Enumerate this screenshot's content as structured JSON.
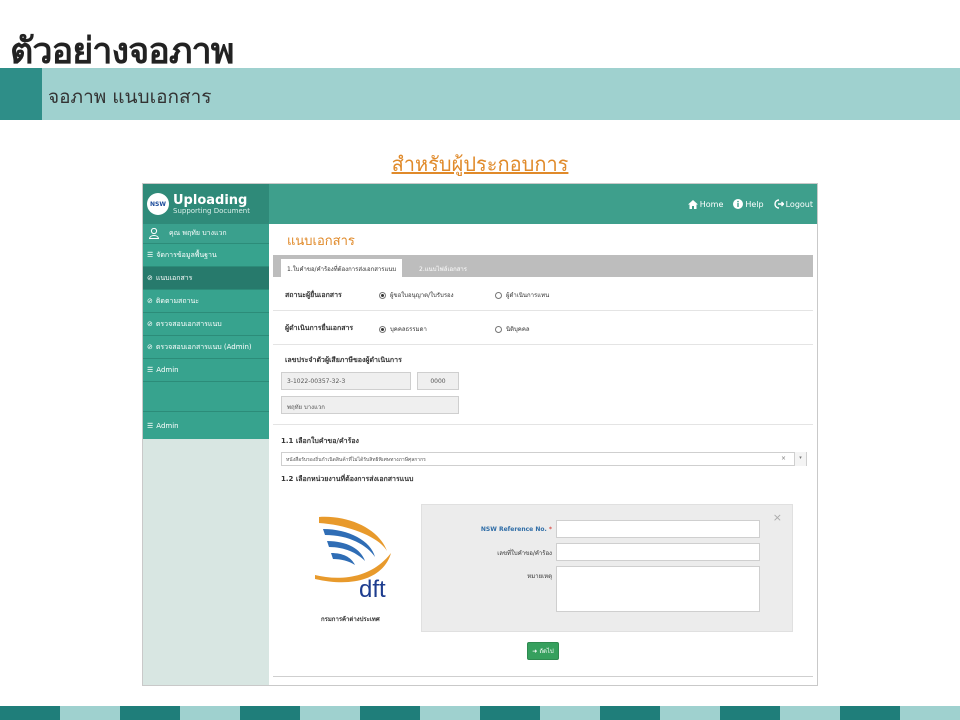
{
  "slide": {
    "title": "ตัวอย่างจอภาพ",
    "subtitle": "จอภาพ แนบเอกสาร",
    "section_heading": "สำหรับผู้ประกอบการ"
  },
  "app": {
    "brand": {
      "logo_text": "NSW",
      "title": "Uploading",
      "subtitle": "Supporting Document"
    },
    "topnav": [
      {
        "label": "Home",
        "icon": "home-icon"
      },
      {
        "label": "Help",
        "icon": "help-icon"
      },
      {
        "label": "Logout",
        "icon": "logout-icon"
      }
    ],
    "sidebar": {
      "user": "คุณ พฤทัย บางแวก",
      "items": [
        {
          "label": "จัดการข้อมูลพื้นฐาน",
          "icon": "menu-icon"
        },
        {
          "label": "แนบเอกสาร",
          "icon": "check-circle-icon"
        },
        {
          "label": "ติดตามสถานะ",
          "icon": "check-circle-icon"
        },
        {
          "label": "ตรวจสอบเอกสารแนบ",
          "icon": "check-circle-icon"
        },
        {
          "label": "ตรวจสอบเอกสารแนบ (Admin)",
          "icon": "check-circle-icon"
        },
        {
          "label": "Admin",
          "icon": "menu-icon"
        }
      ],
      "admin_second": "Admin"
    },
    "page_title": "แนบเอกสาร",
    "tabs": {
      "active": "1.ใบคำขอ/คำร้องที่ต้องการส่งเอกสารแนบ",
      "inactive": "2.แนบไฟล์เอกสาร"
    },
    "submitter_status": {
      "label": "สถานะผู้ยื่นเอกสาร",
      "options": [
        "ผู้ขอใบอนุญาต/ใบรับรอง",
        "ผู้ดำเนินการแทน"
      ],
      "selected": 0
    },
    "submitter_type": {
      "label": "ผู้ดำเนินการยื่นเอกสาร",
      "options": [
        "บุคคลธรรมดา",
        "นิติบุคคล"
      ],
      "selected": 0
    },
    "tax_id": {
      "label": "เลขประจำตัวผู้เสียภาษีของผู้ดำเนินการ",
      "value": "3-1022-00357-32-3",
      "branch": "0000",
      "name": "พฤทัย บางแวก"
    },
    "section_1_1": {
      "label": "1.1 เลือกใบคำขอ/คำร้อง",
      "selected": "หนังสือรับรองถิ่นกำเนิดสินค้าที่ไม่ได้รับสิทธิพิเศษทางภาษีศุลกากร",
      "clear": "×",
      "arrow": "▾"
    },
    "section_1_2": {
      "label": "1.2 เลือกหน่วยงานที่ต้องการส่งเอกสารแนบ"
    },
    "agency": {
      "logo_text": "dft",
      "name": "กรมการค้าต่างประเทศ"
    },
    "form": {
      "ref_label": "NSW Reference No.",
      "ref_required": "*",
      "request_no_label": "เลขที่ใบคำขอ/คำร้อง",
      "remark_label": "หมายเหตุ",
      "close": "×"
    },
    "next_button": "ถัดไป"
  },
  "colors": {
    "accent_orange": "#e08a2a",
    "teal": "#3e9f8c",
    "teal_dark": "#277a6c",
    "band": "#9fd1cf",
    "button_green": "#36a05e"
  }
}
